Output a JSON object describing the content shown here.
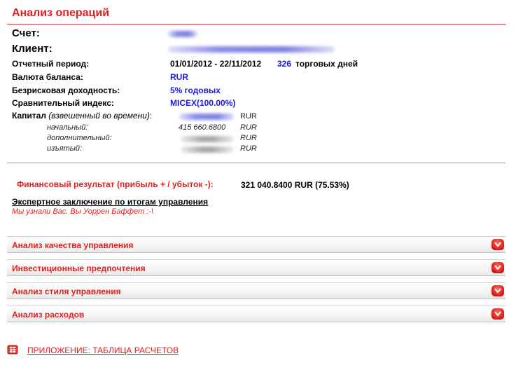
{
  "page": {
    "title": "Анализ операций"
  },
  "account": {
    "label": "Счет:"
  },
  "client": {
    "label": "Клиент:"
  },
  "details": {
    "period_label": "Отчетный период:",
    "period_value": "01/01/2012 - 22/11/2012",
    "trading_days_count": "326",
    "trading_days_text": "торговых дней",
    "currency_label": "Валюта баланса:",
    "currency_value": "RUR",
    "riskfree_label": "Безрисковая доходность:",
    "riskfree_value": "5% годовых",
    "index_label": "Сравнительный индекс:",
    "index_value": "MICEX(100.00%)"
  },
  "capital": {
    "label": "Капитал",
    "label_note": "(взвешенный во времени)",
    "colon": ":",
    "currency": "RUR",
    "initial_label": "начальный:",
    "initial_value": "415 660.6800",
    "additional_label": "дополнительный:",
    "withdrawn_label": "изъятый:"
  },
  "result": {
    "label": "Финансовый результат (прибыль + / убыток -):",
    "value": "321 040.8400 RUR  (75.53%)"
  },
  "expert": {
    "heading": "Экспертное заключение по итогам управления",
    "note": "Мы узнали Вас. Вы Уоррен Баффет :-\\"
  },
  "sections": [
    {
      "label": "Анализ качества управления"
    },
    {
      "label": "Инвестиционные предпочтения"
    },
    {
      "label": "Анализ стиля управления"
    },
    {
      "label": "Анализ расходов"
    }
  ],
  "appendix": {
    "link": "ПРИЛОЖЕНИЕ: ТАБЛИЦА РАСЧЕТОВ"
  },
  "colors": {
    "accent": "#e02020",
    "link_blue": "#1a1adc"
  }
}
